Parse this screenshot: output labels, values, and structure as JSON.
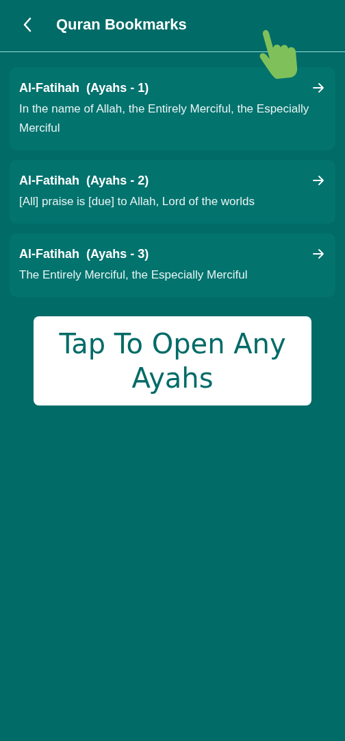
{
  "header": {
    "title": "Quran Bookmarks"
  },
  "bookmarks": [
    {
      "title": "Al-Fatihah  (Ayahs - 1)",
      "text": "In the name of Allah, the Entirely Merciful, the Especially Merciful"
    },
    {
      "title": "Al-Fatihah  (Ayahs - 2)",
      "text": "[All] praise is [due] to Allah, Lord of the worlds"
    },
    {
      "title": "Al-Fatihah  (Ayahs - 3)",
      "text": "The Entirely Merciful, the Especially Merciful"
    }
  ],
  "hint": {
    "text": "Tap To Open Any Ayahs"
  }
}
